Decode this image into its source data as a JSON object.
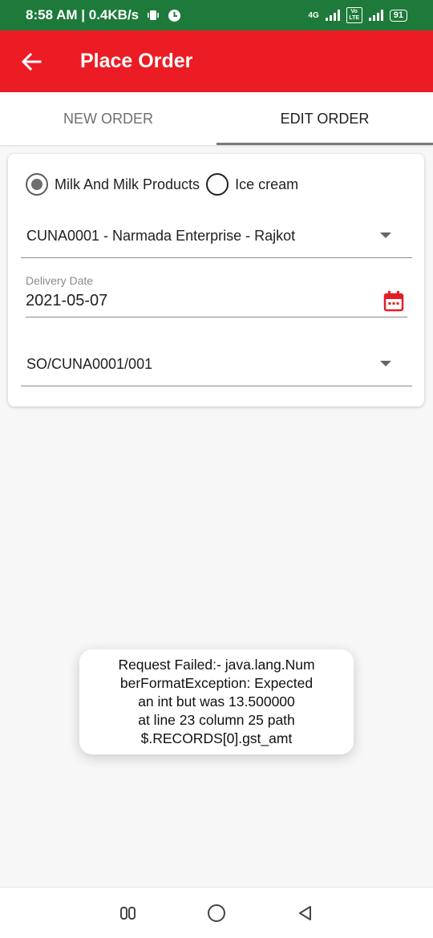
{
  "status_bar": {
    "time_speed": "8:58 AM | 0.4KB/s",
    "network": "4G",
    "volte": "Vo LTE",
    "battery": "91",
    "icons": [
      "vibrate-icon",
      "data-saver-icon",
      "signal-icon",
      "battery-icon"
    ]
  },
  "app_bar": {
    "title": "Place Order",
    "back_icon": "arrow-left-icon",
    "color": "#ec1c24"
  },
  "tabs": [
    {
      "label": "NEW ORDER",
      "selected": false
    },
    {
      "label": "EDIT ORDER",
      "selected": true
    }
  ],
  "form": {
    "category_options": [
      {
        "label": "Milk And Milk Products",
        "checked": true
      },
      {
        "label": "Ice cream",
        "checked": false
      }
    ],
    "customer_select": {
      "value": "CUNA0001 - Narmada Enterprise - Rajkot"
    },
    "delivery_date": {
      "label": "Delivery Date",
      "value": "2021-05-07",
      "icon": "calendar-icon"
    },
    "order_select": {
      "value": "SO/CUNA0001/001"
    }
  },
  "toast": {
    "message": "Request Failed:- java.lang.Num\nberFormatException: Expected\nan int but was 13.500000\nat line 23 column 25 path\n$.RECORDS[0].gst_amt"
  },
  "nav_bar": {
    "buttons": [
      "recents-icon",
      "home-icon",
      "back-triangle-icon"
    ]
  }
}
